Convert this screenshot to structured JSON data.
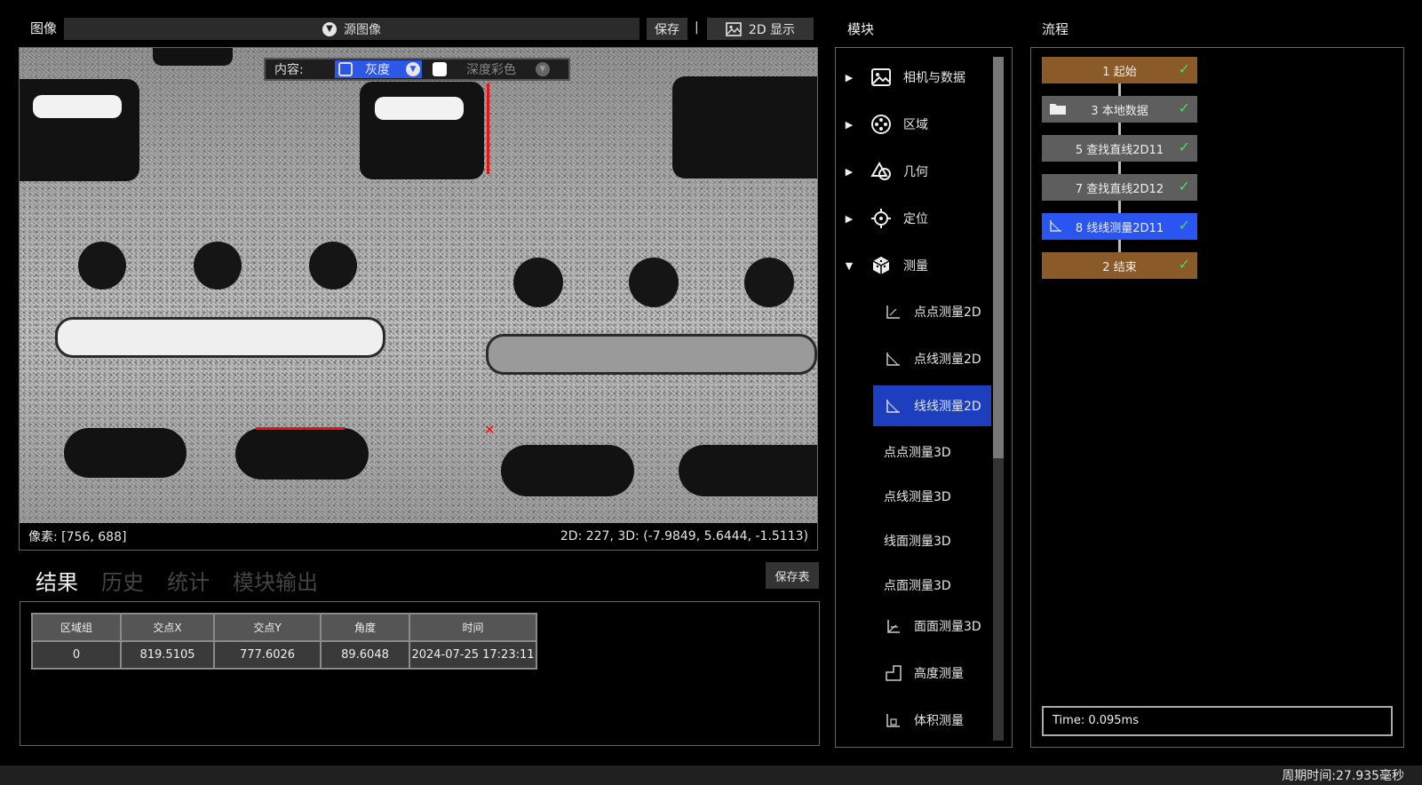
{
  "image_panel": {
    "title": "图像",
    "source_select": "源图像",
    "save_label": "保存",
    "separator": "|",
    "display_mode": "2D 显示",
    "content_label": "内容:",
    "gray_option": "灰度",
    "depth_option": "深度彩色",
    "pixel_info": "像素: [756, 688]",
    "coord_info": "2D: 227, 3D: (-7.9849, 5.6444, -1.5113)"
  },
  "results": {
    "tabs": [
      {
        "label": "结果",
        "active": true
      },
      {
        "label": "历史",
        "active": false
      },
      {
        "label": "统计",
        "active": false
      },
      {
        "label": "模块输出",
        "active": false
      }
    ],
    "save_table_label": "保存表",
    "columns": [
      "区域组",
      "交点X",
      "交点Y",
      "角度",
      "时间"
    ],
    "rows": [
      [
        "0",
        "819.5105",
        "777.6026",
        "89.6048",
        "2024-07-25 17:23:11"
      ]
    ]
  },
  "modules": {
    "title": "模块",
    "categories": [
      {
        "label": "相机与数据",
        "icon": "image-icon",
        "expanded": false
      },
      {
        "label": "区域",
        "icon": "region-icon",
        "expanded": false
      },
      {
        "label": "几何",
        "icon": "geometry-icon",
        "expanded": false
      },
      {
        "label": "定位",
        "icon": "crosshair-icon",
        "expanded": false
      },
      {
        "label": "测量",
        "icon": "measure-cube-icon",
        "expanded": true
      }
    ],
    "sub_items": [
      {
        "label": "点点测量2D",
        "icon": "angle-icon",
        "selected": false
      },
      {
        "label": "点线测量2D",
        "icon": "angle-icon",
        "selected": false
      },
      {
        "label": "线线测量2D",
        "icon": "angle-icon",
        "selected": true
      },
      {
        "label": "点点测量3D",
        "icon": "",
        "selected": false
      },
      {
        "label": "点线测量3D",
        "icon": "",
        "selected": false
      },
      {
        "label": "线面测量3D",
        "icon": "",
        "selected": false
      },
      {
        "label": "点面测量3D",
        "icon": "",
        "selected": false
      },
      {
        "label": "面面测量3D",
        "icon": "angle-3d-icon",
        "selected": false
      },
      {
        "label": "高度测量",
        "icon": "height-icon",
        "selected": false
      },
      {
        "label": "体积测量",
        "icon": "volume-icon",
        "selected": false
      }
    ]
  },
  "flow": {
    "title": "流程",
    "nodes": [
      {
        "label": "1 起始",
        "color": "#8a5a28",
        "icon": ""
      },
      {
        "label": "3 本地数据",
        "color": "#5e5e5e",
        "icon": "folder-icon"
      },
      {
        "label": "5 查找直线2D11",
        "color": "#5e5e5e",
        "icon": ""
      },
      {
        "label": "7 查找直线2D12",
        "color": "#5e5e5e",
        "icon": ""
      },
      {
        "label": "8 线线测量2D11",
        "color": "#2a55f0",
        "icon": "angle-icon"
      },
      {
        "label": "2 结束",
        "color": "#8a5a28",
        "icon": ""
      }
    ],
    "time_text": "Time: 0.095ms"
  },
  "status": {
    "cycle_time": "周期时间:27.935毫秒"
  }
}
